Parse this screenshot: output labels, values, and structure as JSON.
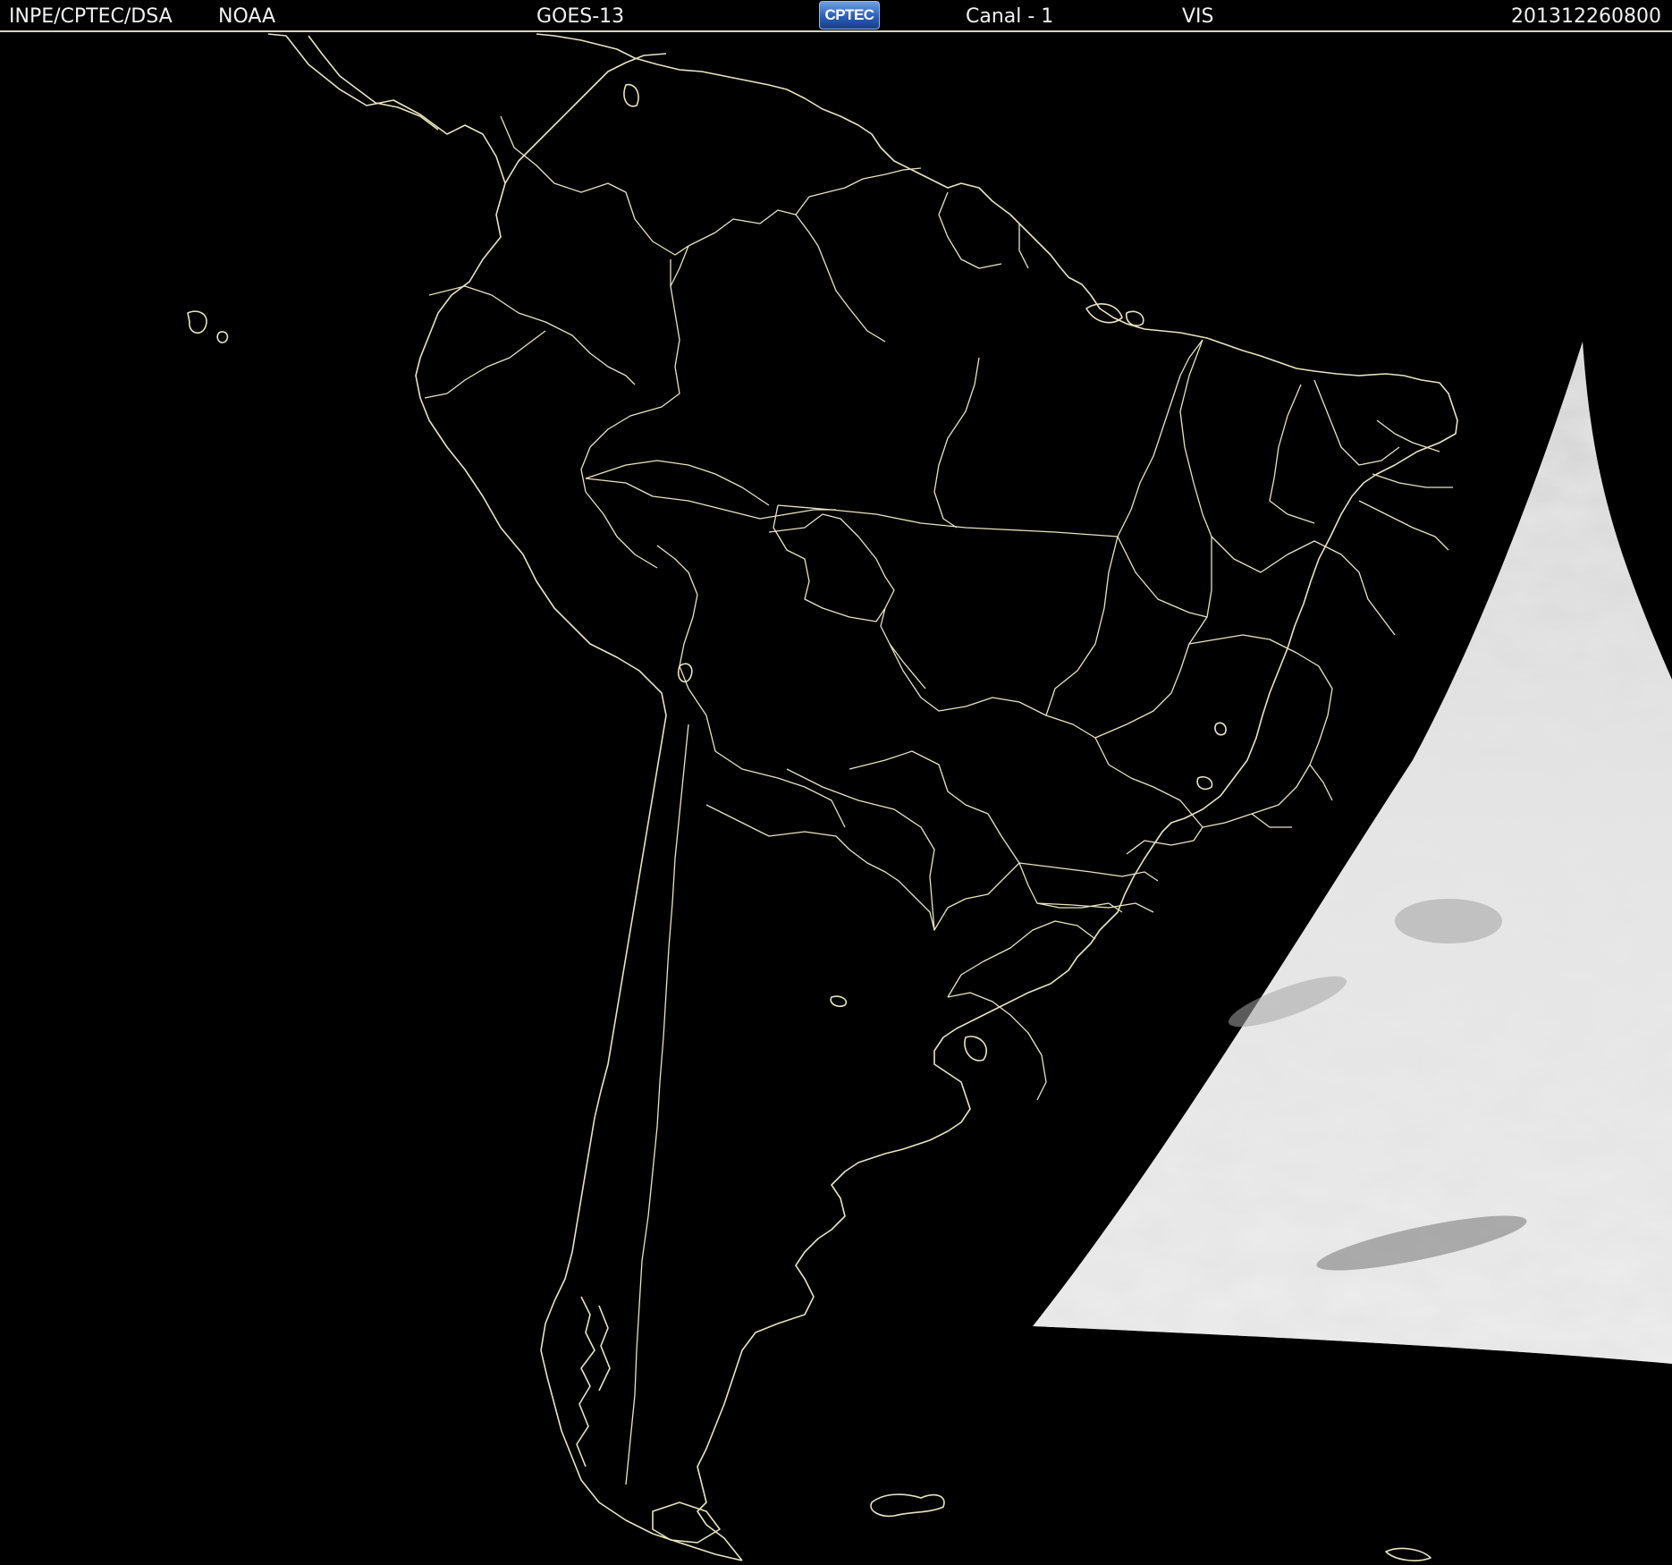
{
  "header": {
    "institution": "INPE/CPTEC/DSA",
    "agency": "NOAA",
    "satellite": "GOES-13",
    "logo_text": "CPTEC",
    "channel": "Canal - 1",
    "band": "VIS",
    "timestamp": "201312260800"
  },
  "map": {
    "region": "South America",
    "line_color": "#e9e4bf",
    "background_color": "#000000",
    "imagery_tone": "#d9d9d9"
  }
}
